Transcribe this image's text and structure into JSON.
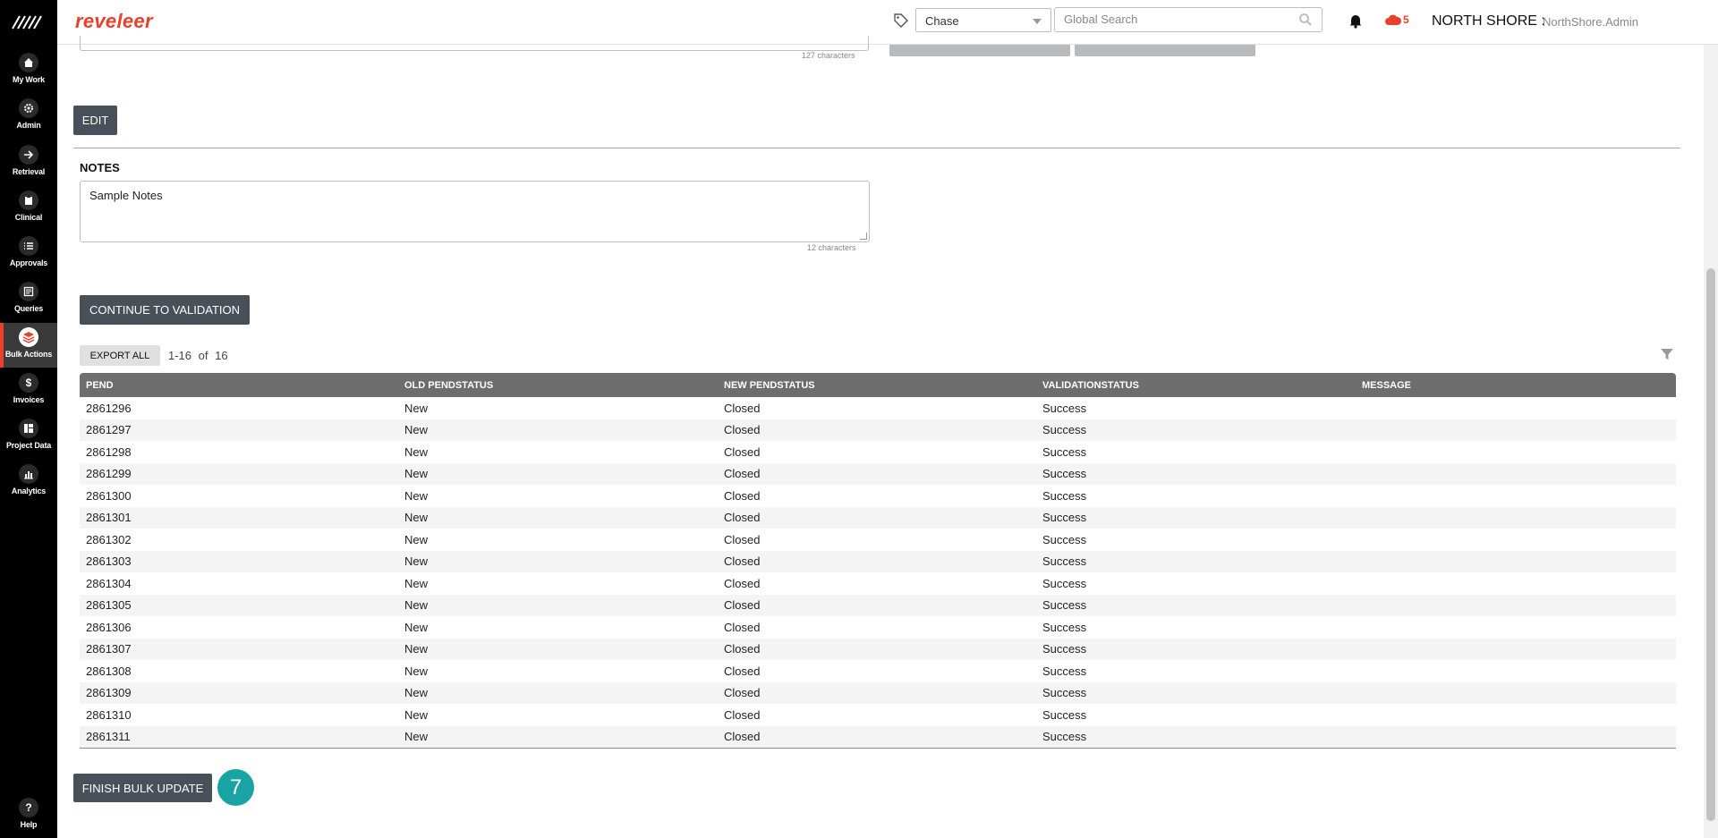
{
  "app": {
    "brand": "reveleer"
  },
  "sidebar": {
    "items": [
      {
        "label": "My Work",
        "icon": "house-icon"
      },
      {
        "label": "Admin",
        "icon": "gear-icon"
      },
      {
        "label": "Retrieval",
        "icon": "arrow-right-icon"
      },
      {
        "label": "Clinical",
        "icon": "clipboard-icon"
      },
      {
        "label": "Approvals",
        "icon": "list-icon"
      },
      {
        "label": "Queries",
        "icon": "document-icon"
      },
      {
        "label": "Bulk Actions",
        "icon": "layers-icon",
        "active": true
      },
      {
        "label": "Invoices",
        "icon": "dollar-icon"
      },
      {
        "label": "Project Data",
        "icon": "grid-icon"
      },
      {
        "label": "Analytics",
        "icon": "bar-chart-icon"
      }
    ],
    "help_label": "Help"
  },
  "header": {
    "project_select": "Chase",
    "search_placeholder": "Global Search",
    "cloud_count": "5",
    "org_name": "NORTH SHORE :",
    "user_name": "NorthShore.Admin"
  },
  "main": {
    "top_char_count": "127 characters",
    "edit_button": "EDIT",
    "notes_label": "NOTES",
    "notes_value": "Sample Notes",
    "notes_char_count": "12 characters",
    "continue_button": "CONTINUE TO VALIDATION",
    "export_button": "EXPORT ALL",
    "pager_range": "1-16",
    "pager_of": "of",
    "pager_total": "16",
    "finish_button": "FINISH BULK UPDATE",
    "step_badge": "7"
  },
  "table": {
    "columns": [
      "PEND",
      "OLD PENDSTATUS",
      "NEW PENDSTATUS",
      "VALIDATIONSTATUS",
      "MESSAGE"
    ],
    "rows": [
      [
        "2861296",
        "New",
        "Closed",
        "Success",
        ""
      ],
      [
        "2861297",
        "New",
        "Closed",
        "Success",
        ""
      ],
      [
        "2861298",
        "New",
        "Closed",
        "Success",
        ""
      ],
      [
        "2861299",
        "New",
        "Closed",
        "Success",
        ""
      ],
      [
        "2861300",
        "New",
        "Closed",
        "Success",
        ""
      ],
      [
        "2861301",
        "New",
        "Closed",
        "Success",
        ""
      ],
      [
        "2861302",
        "New",
        "Closed",
        "Success",
        ""
      ],
      [
        "2861303",
        "New",
        "Closed",
        "Success",
        ""
      ],
      [
        "2861304",
        "New",
        "Closed",
        "Success",
        ""
      ],
      [
        "2861305",
        "New",
        "Closed",
        "Success",
        ""
      ],
      [
        "2861306",
        "New",
        "Closed",
        "Success",
        ""
      ],
      [
        "2861307",
        "New",
        "Closed",
        "Success",
        ""
      ],
      [
        "2861308",
        "New",
        "Closed",
        "Success",
        ""
      ],
      [
        "2861309",
        "New",
        "Closed",
        "Success",
        ""
      ],
      [
        "2861310",
        "New",
        "Closed",
        "Success",
        ""
      ],
      [
        "2861311",
        "New",
        "Closed",
        "Success",
        ""
      ]
    ]
  },
  "colors": {
    "brand": "#e8402b",
    "sidebar_bg": "#000000",
    "button_dark": "#4a5059",
    "table_header": "#6d6d6d",
    "badge": "#1aa3a3"
  }
}
